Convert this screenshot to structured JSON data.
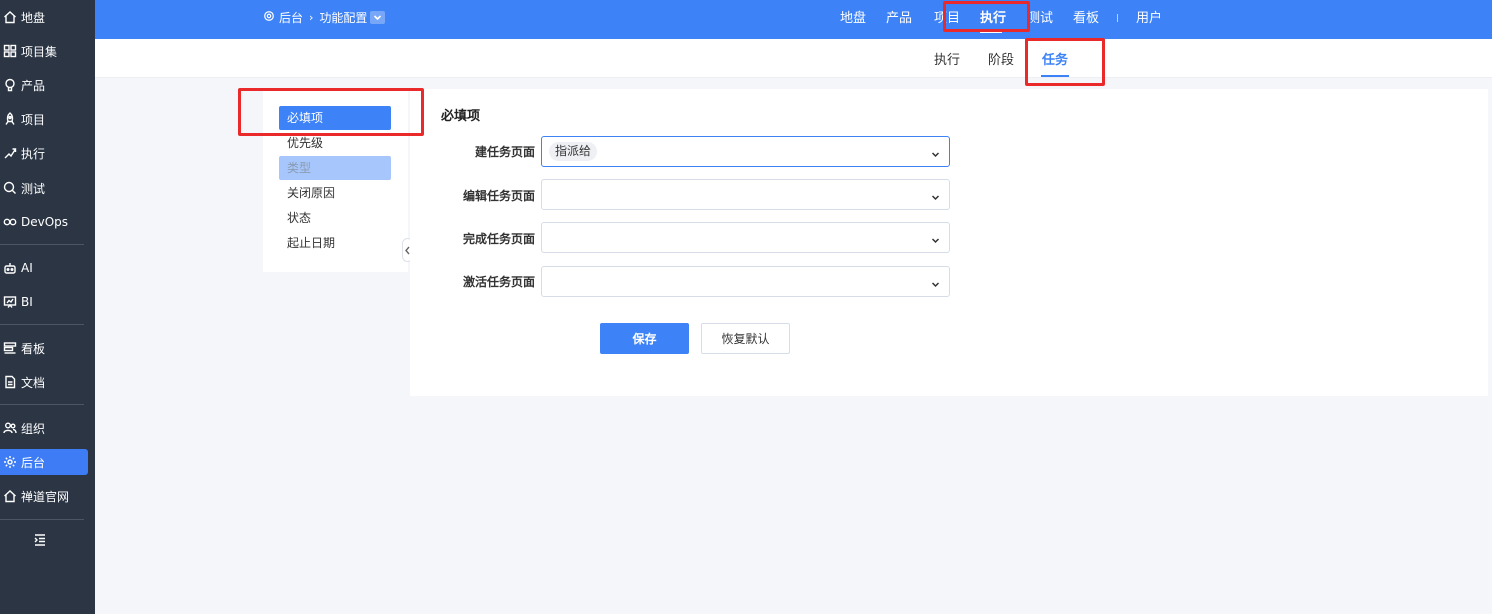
{
  "sidebar": {
    "items": [
      {
        "label": "地盘",
        "icon": "home-icon"
      },
      {
        "label": "项目集",
        "icon": "grid-icon"
      },
      {
        "label": "产品",
        "icon": "bulb-icon"
      },
      {
        "label": "项目",
        "icon": "rocket-icon"
      },
      {
        "label": "执行",
        "icon": "run-icon"
      },
      {
        "label": "测试",
        "icon": "bug-search-icon"
      },
      {
        "label": "DevOps",
        "icon": "infinity-icon"
      },
      {
        "label": "AI",
        "icon": "robot-icon"
      },
      {
        "label": "BI",
        "icon": "chart-board-icon"
      },
      {
        "label": "看板",
        "icon": "kanban-icon"
      },
      {
        "label": "文档",
        "icon": "document-icon"
      },
      {
        "label": "组织",
        "icon": "people-icon"
      },
      {
        "label": "后台",
        "icon": "gear-icon",
        "active": true
      },
      {
        "label": "禅道官网",
        "icon": "home-icon"
      }
    ],
    "collapse_icon": "indent-icon"
  },
  "header": {
    "breadcrumb": {
      "root": "后台",
      "current": "功能配置"
    },
    "nav": [
      {
        "label": "地盘"
      },
      {
        "label": "产品"
      },
      {
        "label": "项目"
      },
      {
        "label": "执行",
        "active": true
      },
      {
        "label": "测试"
      },
      {
        "label": "看板"
      },
      {
        "label": "用户"
      }
    ]
  },
  "subnav": {
    "items": [
      {
        "label": "执行"
      },
      {
        "label": "阶段"
      },
      {
        "label": "任务",
        "active": true
      }
    ]
  },
  "side_menu": {
    "items": [
      {
        "label": "必填项",
        "active": true
      },
      {
        "label": "优先级"
      },
      {
        "label": "类型",
        "hover": true
      },
      {
        "label": "关闭原因"
      },
      {
        "label": "状态"
      },
      {
        "label": "起止日期"
      }
    ]
  },
  "form": {
    "title": "必填项",
    "fields": [
      {
        "label": "建任务页面",
        "tags": [
          "指派给"
        ],
        "focused": true
      },
      {
        "label": "编辑任务页面",
        "tags": []
      },
      {
        "label": "完成任务页面",
        "tags": []
      },
      {
        "label": "激活任务页面",
        "tags": []
      }
    ],
    "save_label": "保存",
    "reset_label": "恢复默认"
  },
  "colors": {
    "primary": "#3d82f6",
    "sidebar_bg": "#2b3544",
    "annotation": "#ea2a2a"
  }
}
